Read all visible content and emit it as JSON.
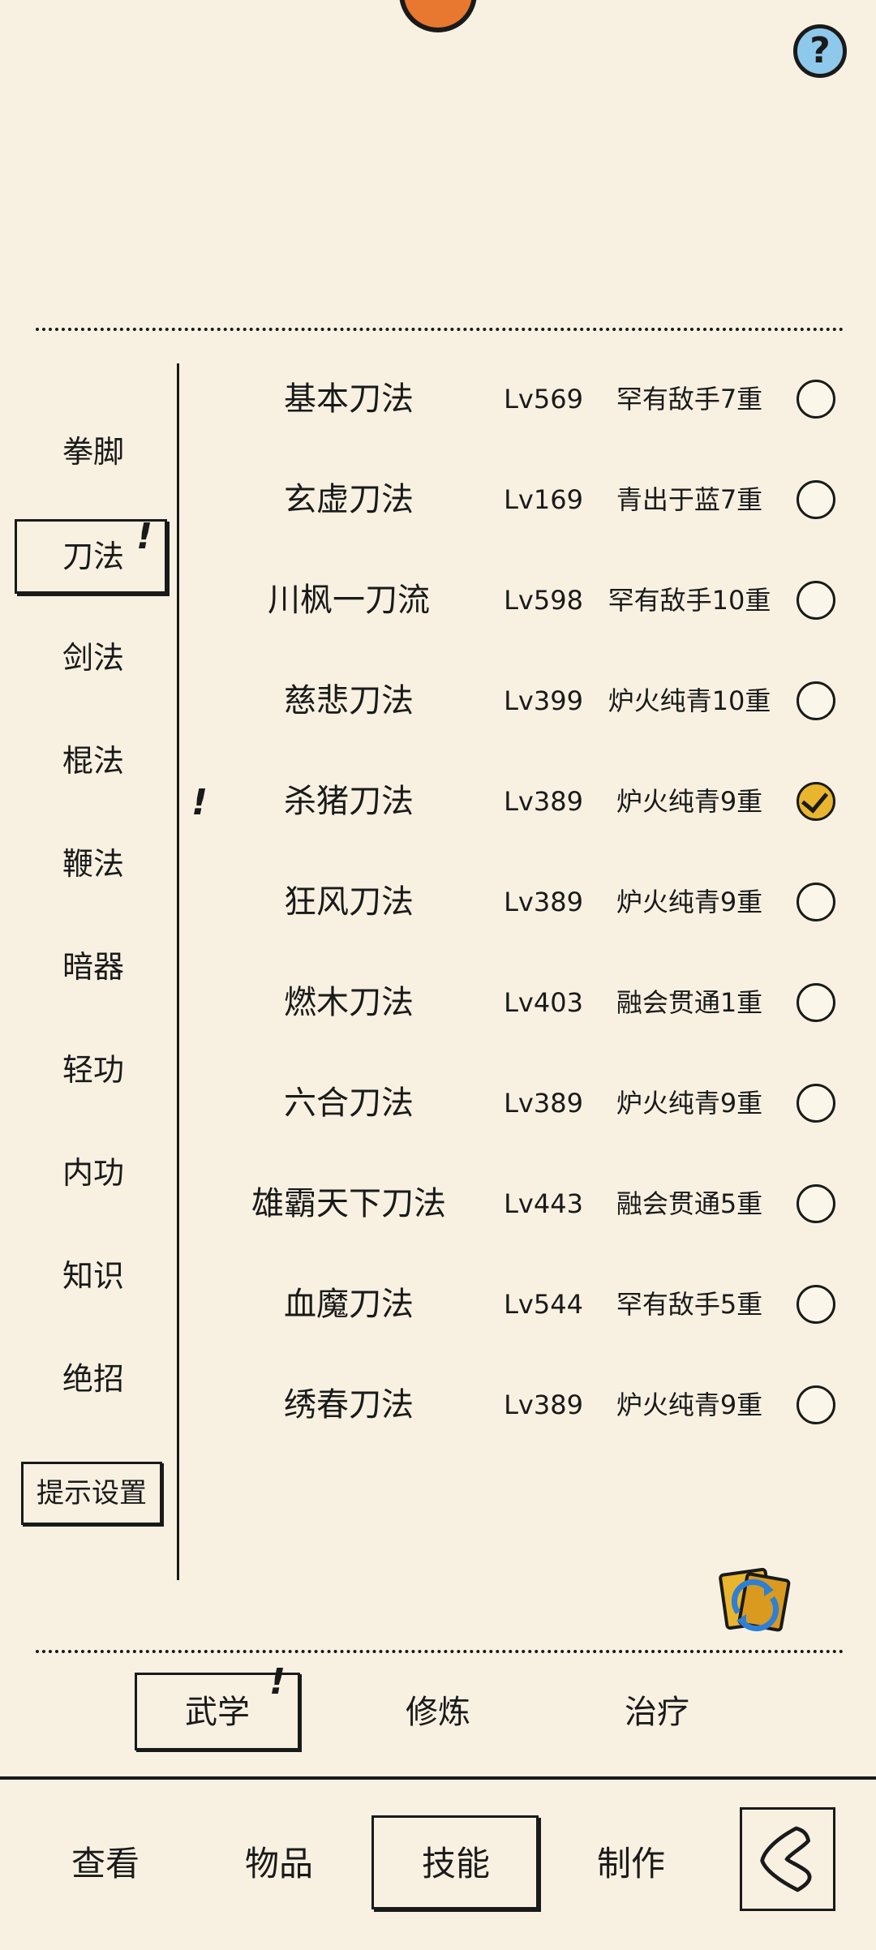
{
  "help": {
    "label": "?"
  },
  "sidebar": {
    "items": [
      {
        "label": "拳脚"
      },
      {
        "label": "刀法",
        "badge": "!"
      },
      {
        "label": "剑法"
      },
      {
        "label": "棍法"
      },
      {
        "label": "鞭法"
      },
      {
        "label": "暗器"
      },
      {
        "label": "轻功"
      },
      {
        "label": "内功"
      },
      {
        "label": "知识"
      },
      {
        "label": "绝招"
      }
    ],
    "hint_settings": "提示设置"
  },
  "skills": [
    {
      "name": "基本刀法",
      "level": "Lv569",
      "rank": "罕有敌手7重",
      "checked": false
    },
    {
      "name": "玄虚刀法",
      "level": "Lv169",
      "rank": "青出于蓝7重",
      "checked": false
    },
    {
      "name": "川枫一刀流",
      "level": "Lv598",
      "rank": "罕有敌手10重",
      "checked": false
    },
    {
      "name": "慈悲刀法",
      "level": "Lv399",
      "rank": "炉火纯青10重",
      "checked": false
    },
    {
      "name": "杀猪刀法",
      "level": "Lv389",
      "rank": "炉火纯青9重",
      "checked": true,
      "badge": "!"
    },
    {
      "name": "狂风刀法",
      "level": "Lv389",
      "rank": "炉火纯青9重",
      "checked": false
    },
    {
      "name": "燃木刀法",
      "level": "Lv403",
      "rank": "融会贯通1重",
      "checked": false
    },
    {
      "name": "六合刀法",
      "level": "Lv389",
      "rank": "炉火纯青9重",
      "checked": false
    },
    {
      "name": "雄霸天下刀法",
      "level": "Lv443",
      "rank": "融会贯通5重",
      "checked": false
    },
    {
      "name": "血魔刀法",
      "level": "Lv544",
      "rank": "罕有敌手5重",
      "checked": false
    },
    {
      "name": "绣春刀法",
      "level": "Lv389",
      "rank": "炉火纯青9重",
      "checked": false
    }
  ],
  "subtabs": [
    {
      "label": "武学",
      "badge": "!"
    },
    {
      "label": "修炼"
    },
    {
      "label": "治疗"
    }
  ],
  "nav": [
    {
      "label": "查看"
    },
    {
      "label": "物品"
    },
    {
      "label": "技能"
    },
    {
      "label": "制作"
    }
  ],
  "colors": {
    "background": "#f8f1e2",
    "check_active": "#e9b52e",
    "help_bg": "#8ec9ec",
    "mascot": "#e8782f"
  }
}
